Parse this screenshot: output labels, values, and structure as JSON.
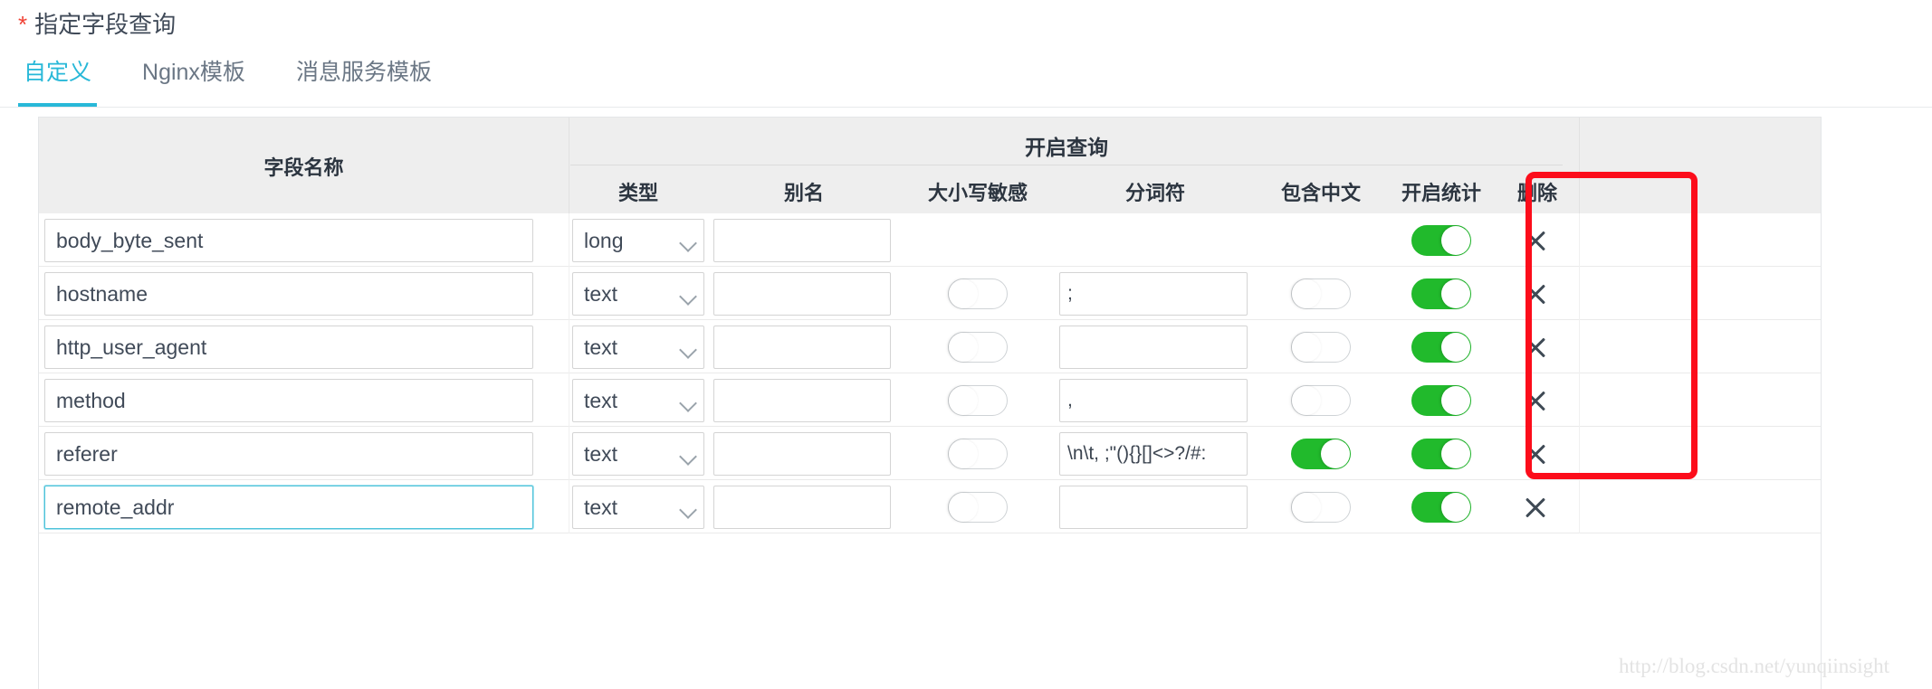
{
  "form": {
    "required_mark": "*",
    "label": "指定字段查询"
  },
  "tabs": [
    {
      "label": "自定义",
      "active": true
    },
    {
      "label": "Nginx模板",
      "active": false
    },
    {
      "label": "消息服务模板",
      "active": false
    }
  ],
  "table": {
    "group_header": "开启查询",
    "columns": {
      "field_name": "字段名称",
      "type": "类型",
      "alias": "别名",
      "case_sensitive": "大小写敏感",
      "tokenizer": "分词符",
      "contains_chinese": "包含中文",
      "enable_stats": "开启统计",
      "delete": "删除"
    },
    "rows": [
      {
        "field_name": "body_byte_sent",
        "type": "long",
        "alias": "",
        "case_sensitive": null,
        "tokenizer": null,
        "contains_chinese": null,
        "enable_stats": true,
        "focused": false
      },
      {
        "field_name": "hostname",
        "type": "text",
        "alias": "",
        "case_sensitive": false,
        "tokenizer": ";",
        "contains_chinese": false,
        "enable_stats": true,
        "focused": false
      },
      {
        "field_name": "http_user_agent",
        "type": "text",
        "alias": "",
        "case_sensitive": false,
        "tokenizer": "",
        "contains_chinese": false,
        "enable_stats": true,
        "focused": false
      },
      {
        "field_name": "method",
        "type": "text",
        "alias": "",
        "case_sensitive": false,
        "tokenizer": ",",
        "contains_chinese": false,
        "enable_stats": true,
        "focused": false
      },
      {
        "field_name": "referer",
        "type": "text",
        "alias": "",
        "case_sensitive": false,
        "tokenizer": "\\n\\t, ;\"(){}[]<>?/#:",
        "contains_chinese": true,
        "enable_stats": true,
        "focused": false
      },
      {
        "field_name": "remote_addr",
        "type": "text",
        "alias": "",
        "case_sensitive": false,
        "tokenizer": "",
        "contains_chinese": false,
        "enable_stats": true,
        "focused": true
      }
    ]
  },
  "annotation": {
    "highlight_color": "#fc0d1b",
    "highlighted_column": "包含中文"
  },
  "watermark": "http://blog.csdn.net/yunqiinsight",
  "colors": {
    "accent": "#28b8d8",
    "toggle_on": "#21ba2c",
    "required": "#f04134",
    "header_bg": "#eeeeee"
  }
}
